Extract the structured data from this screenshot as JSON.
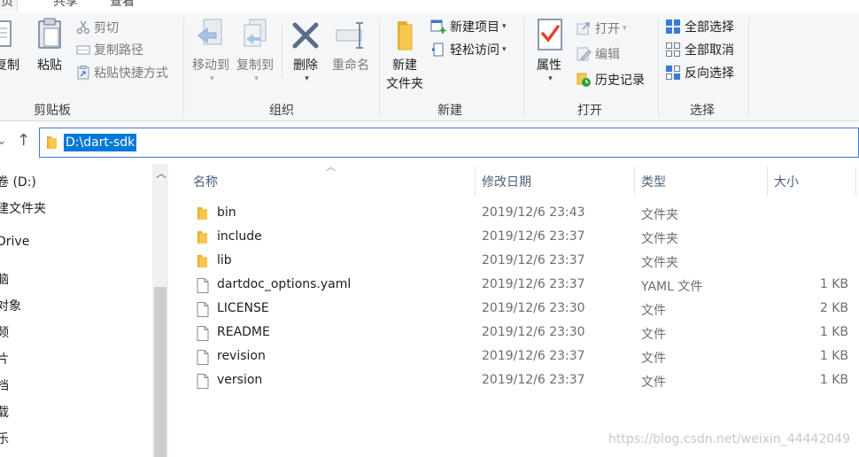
{
  "tabs": {
    "home": "主页",
    "share": "共享",
    "view": "查看"
  },
  "ribbon": {
    "clipboard": {
      "label": "剪贴板",
      "copy": "复制",
      "paste": "粘贴",
      "cut": "剪切",
      "copy_path": "复制路径",
      "paste_shortcut": "粘贴快捷方式"
    },
    "organize": {
      "label": "组织",
      "move_to": "移动到",
      "copy_to": "复制到",
      "delete": "删除",
      "rename": "重命名"
    },
    "new": {
      "label": "新建",
      "new_item": "新建项目",
      "easy_access": "轻松访问",
      "new_folder_line1": "新建",
      "new_folder_line2": "文件夹"
    },
    "open": {
      "label": "打开",
      "properties": "属性",
      "open": "打开",
      "edit": "编辑",
      "history": "历史记录"
    },
    "select": {
      "label": "选择",
      "select_all": "全部选择",
      "select_none": "全部取消",
      "invert": "反向选择"
    }
  },
  "address": {
    "path": "D:\\dart-sdk"
  },
  "nav_pane": {
    "items": [
      "卷 (D:)",
      "建文件夹",
      "Drive",
      "脑",
      "对象",
      "频",
      "片",
      "档",
      "载",
      "乐"
    ]
  },
  "columns": {
    "name": "名称",
    "date": "修改日期",
    "type": "类型",
    "size": "大小"
  },
  "files": [
    {
      "name": "bin",
      "date": "2019/12/6 23:43",
      "type": "文件夹",
      "size": "",
      "icon": "folder-icon"
    },
    {
      "name": "include",
      "date": "2019/12/6 23:37",
      "type": "文件夹",
      "size": "",
      "icon": "folder-icon"
    },
    {
      "name": "lib",
      "date": "2019/12/6 23:37",
      "type": "文件夹",
      "size": "",
      "icon": "folder-icon"
    },
    {
      "name": "dartdoc_options.yaml",
      "date": "2019/12/6 23:37",
      "type": "YAML 文件",
      "size": "1 KB",
      "icon": "file-icon"
    },
    {
      "name": "LICENSE",
      "date": "2019/12/6 23:30",
      "type": "文件",
      "size": "2 KB",
      "icon": "file-icon"
    },
    {
      "name": "README",
      "date": "2019/12/6 23:30",
      "type": "文件",
      "size": "1 KB",
      "icon": "file-icon"
    },
    {
      "name": "revision",
      "date": "2019/12/6 23:37",
      "type": "文件",
      "size": "1 KB",
      "icon": "file-icon"
    },
    {
      "name": "version",
      "date": "2019/12/6 23:37",
      "type": "文件",
      "size": "1 KB",
      "icon": "file-icon"
    }
  ],
  "watermark": "https://blog.csdn.net/weixin_44442049",
  "colors": {
    "accent": "#0078d7",
    "folder": "#f5c33b",
    "header_text": "#4c607a"
  }
}
